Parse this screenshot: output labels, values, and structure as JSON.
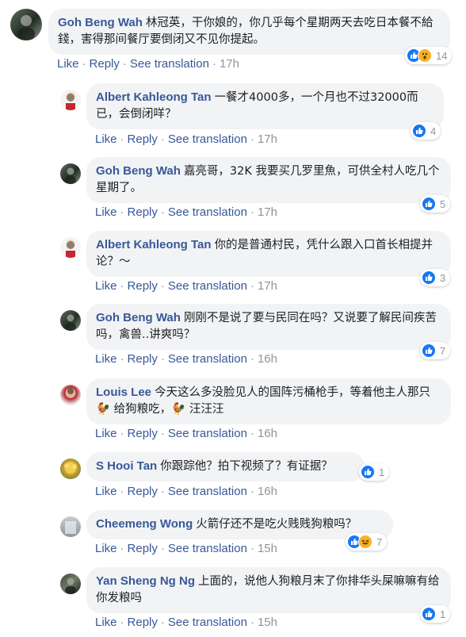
{
  "actions": {
    "like": "Like",
    "reply": "Reply",
    "see_translation": "See translation",
    "separator": "·"
  },
  "colors": {
    "author_link": "#385898",
    "bubble_bg": "#f2f3f5",
    "like_blue": "#1877f2",
    "emoji_yellow": "#f7b125"
  },
  "comments": [
    {
      "author": "Goh Beng Wah",
      "text": "林冠英，干你娘的，你几乎每个星期两天去吃日本餐不給錢，害得那间餐厅要倒闭又不见你提起。",
      "time": "17h",
      "reaction_count": "14",
      "reactions": [
        "like-icon",
        "wow-icon"
      ]
    },
    {
      "author": "Albert Kahleong Tan",
      "text": "一餐才4000多，一个月也不过32000而已，会倒闭咩？",
      "time": "17h",
      "reaction_count": "4",
      "reactions": [
        "like-icon"
      ]
    },
    {
      "author": "Goh Beng Wah",
      "text": "嘉亮哥，32K 我要买几罗里魚，可供全村人吃几个星期了。",
      "time": "17h",
      "reaction_count": "5",
      "reactions": [
        "like-icon"
      ]
    },
    {
      "author": "Albert Kahleong Tan",
      "text": "你的是普通村民，凭什么跟入口首长相提并论？～",
      "time": "17h",
      "reaction_count": "3",
      "reactions": [
        "like-icon"
      ]
    },
    {
      "author": "Goh Beng Wah",
      "text": "刚刚不是说了要与民同在吗？又说要了解民间疾苦吗，禽兽..讲爽吗？",
      "time": "16h",
      "reaction_count": "7",
      "reactions": [
        "like-icon"
      ]
    },
    {
      "author": "Louis Lee",
      "text": "今天这么多没脸见人的国阵污桶枪手，等着他主人那只 🐓 给狗粮吃，🐓 汪汪汪",
      "time": "16h",
      "reaction_count": "",
      "reactions": []
    },
    {
      "author": "S Hooi Tan",
      "text": "你跟踪他？拍下视频了？有证据？",
      "time": "16h",
      "reaction_count": "1",
      "reactions": [
        "like-icon"
      ]
    },
    {
      "author": "Cheemeng Wong",
      "text": "火箭仔还不是吃火贱贱狗粮吗？",
      "time": "15h",
      "reaction_count": "7",
      "reactions": [
        "like-icon",
        "haha-icon"
      ]
    },
    {
      "author": "Yan Sheng Ng Ng",
      "text": "上面的，说他人狗粮月末了你排华头屎嘛嘛有给你发粮吗",
      "time": "15h",
      "reaction_count": "1",
      "reactions": [
        "like-icon"
      ]
    }
  ]
}
